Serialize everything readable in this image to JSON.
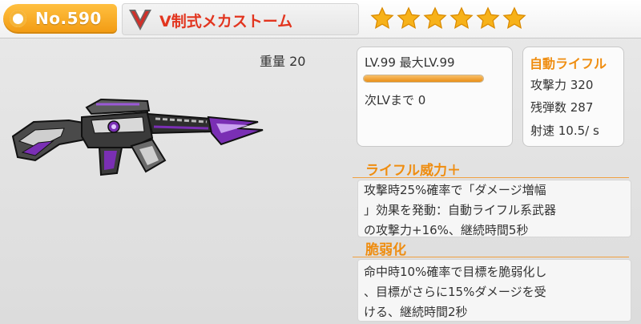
{
  "header": {
    "number": "No.590",
    "weapon_name": "V制式メカストーム",
    "stars": 6,
    "emblem_icon": "v-emblem-icon"
  },
  "weapon": {
    "weight": "重量 20",
    "image_icon": "rifle-illustration"
  },
  "level": {
    "text": "LV.99 最大LV.99",
    "progress": 1.0,
    "next": "次LVまで 0"
  },
  "stats": {
    "type": "自動ライフル",
    "attack": "攻撃力 320",
    "ammo": "残弾数 287",
    "rate": "射速 10.5/ s"
  },
  "skills": [
    {
      "title": "ライフル威力＋",
      "lines": [
        "攻撃時25%確率で「ダメージ増幅",
        "」効果を発動：自動ライフル系武器",
        "の攻撃力+16%、継続時間5秒"
      ]
    },
    {
      "title": "脆弱化",
      "lines": [
        "命中時10%確率で目標を脆弱化し",
        "、目標がさらに15%ダメージを受",
        "ける、継続時間2秒"
      ]
    }
  ],
  "colors": {
    "accent_orange": "#ef8d10",
    "name_red": "#e2351f",
    "star_gold": "#f7b21a",
    "weapon_purple": "#7a2fb4"
  }
}
